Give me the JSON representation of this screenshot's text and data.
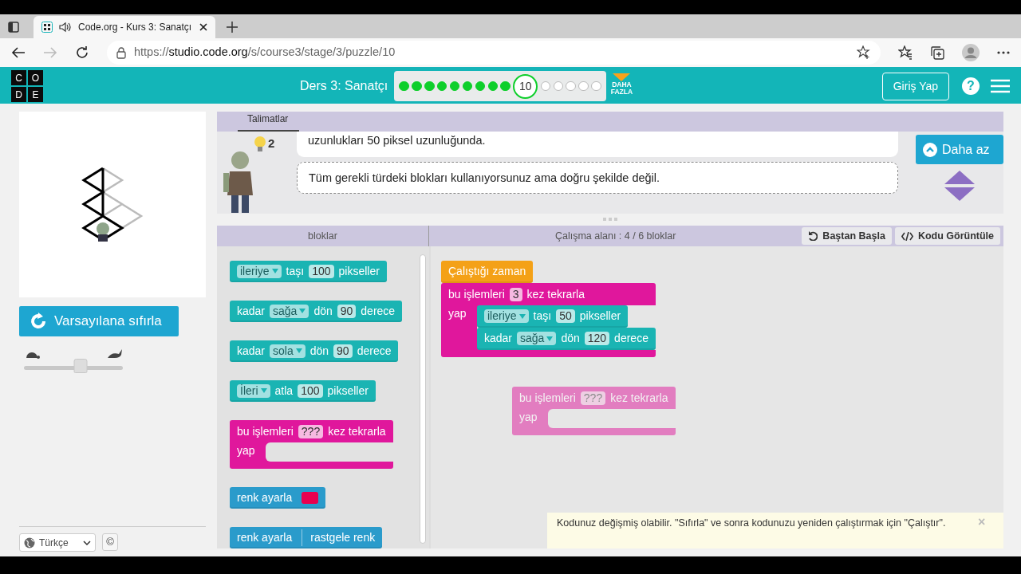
{
  "browser": {
    "tab_title": "Code.org - Kurs 3: Sanatçı",
    "url_scheme": "https://",
    "url_host": "studio.code.org",
    "url_path": "/s/course3/stage/3/puzzle/10"
  },
  "header": {
    "logo_letters": [
      "C",
      "O",
      "D",
      "E"
    ],
    "lesson": "Ders 3: Sanatçı",
    "more": [
      "DAHA",
      "FAZLA"
    ],
    "sign_in": "Giriş Yap",
    "help": "?",
    "progress": [
      {
        "completed": true,
        "selected": false
      },
      {
        "completed": true,
        "selected": false
      },
      {
        "completed": true,
        "selected": false
      },
      {
        "completed": true,
        "selected": false
      },
      {
        "completed": true,
        "selected": false
      },
      {
        "completed": true,
        "selected": false
      },
      {
        "completed": true,
        "selected": false
      },
      {
        "completed": true,
        "selected": false
      },
      {
        "completed": true,
        "selected": false
      },
      {
        "label": "10",
        "completed": false,
        "selected": true
      },
      {
        "completed": false,
        "selected": false
      },
      {
        "completed": false,
        "selected": false
      },
      {
        "completed": false,
        "selected": false
      },
      {
        "completed": false,
        "selected": false
      },
      {
        "completed": false,
        "selected": false
      }
    ]
  },
  "left": {
    "reset_button": "Varsayılana sıfırla",
    "speed": {
      "level": 0.57
    },
    "language": "Türkçe",
    "copyright": "©"
  },
  "instructions": {
    "tab": "Talimatlar",
    "hint_count": "2",
    "toggle_button": "Daha az",
    "messages": [
      {
        "kind": "instruction",
        "text": "uzunlukları 50 piksel uzunluğunda."
      },
      {
        "kind": "feedback",
        "text": "Tüm gerekli türdeki blokları kullanıyorsunuz ama doğru şekilde değil."
      }
    ]
  },
  "workspace_header": {
    "toolbox_title": "bloklar",
    "workspace_title": "Çalışma alanı : 4 / 6 bloklar",
    "buttons": [
      {
        "kind": "restart",
        "label": "Baştan Başla"
      },
      {
        "kind": "code",
        "label": "Kodu Görüntüle"
      }
    ]
  },
  "toolbox": [
    {
      "kind": "action",
      "parts": [
        {
          "kind": "dropdown",
          "text": "ileriye"
        },
        {
          "kind": "text",
          "text": "taşı"
        },
        {
          "kind": "number",
          "text": "100"
        },
        {
          "kind": "text",
          "text": "pikseller"
        }
      ]
    },
    {
      "kind": "action",
      "parts": [
        {
          "kind": "text",
          "text": "kadar"
        },
        {
          "kind": "dropdown",
          "text": "sağa"
        },
        {
          "kind": "text",
          "text": "dön"
        },
        {
          "kind": "number",
          "text": "90"
        },
        {
          "kind": "text",
          "text": "derece"
        }
      ]
    },
    {
      "kind": "action",
      "parts": [
        {
          "kind": "text",
          "text": "kadar"
        },
        {
          "kind": "dropdown",
          "text": "sola"
        },
        {
          "kind": "text",
          "text": "dön"
        },
        {
          "kind": "number",
          "text": "90"
        },
        {
          "kind": "text",
          "text": "derece"
        }
      ]
    },
    {
      "kind": "action",
      "parts": [
        {
          "kind": "dropdown",
          "text": "İleri"
        },
        {
          "kind": "text",
          "text": "atla"
        },
        {
          "kind": "number",
          "text": "100"
        },
        {
          "kind": "text",
          "text": "pikseller"
        }
      ]
    },
    {
      "kind": "repeat",
      "parts": [
        {
          "kind": "text",
          "text": "bu işlemleri"
        },
        {
          "kind": "number",
          "text": "???"
        },
        {
          "kind": "text",
          "text": "kez tekrarla"
        }
      ],
      "body_label": "yap"
    },
    {
      "kind": "pen",
      "parts": [
        {
          "kind": "text",
          "text": "renk ayarla"
        },
        {
          "kind": "swatch",
          "color": "#e8004f"
        }
      ]
    },
    {
      "kind": "pen",
      "parts": [
        {
          "kind": "text",
          "text": "renk ayarla"
        },
        {
          "kind": "value",
          "text": "rastgele renk"
        }
      ]
    }
  ],
  "workspace": [
    {
      "kind": "event",
      "disabled": false,
      "parts": [
        {
          "kind": "text",
          "text": "Çalıştığı zaman"
        }
      ],
      "next": [
        {
          "kind": "repeat",
          "parts": [
            {
              "kind": "text",
              "text": "bu işlemleri"
            },
            {
              "kind": "number",
              "text": "3"
            },
            {
              "kind": "text",
              "text": "kez tekrarla"
            }
          ],
          "body_label": "yap",
          "children": [
            {
              "kind": "action",
              "parts": [
                {
                  "kind": "dropdown",
                  "text": "ileriye"
                },
                {
                  "kind": "text",
                  "text": "taşı"
                },
                {
                  "kind": "number",
                  "text": "50"
                },
                {
                  "kind": "text",
                  "text": "pikseller"
                }
              ]
            },
            {
              "kind": "action",
              "parts": [
                {
                  "kind": "text",
                  "text": "kadar"
                },
                {
                  "kind": "dropdown",
                  "text": "sağa"
                },
                {
                  "kind": "text",
                  "text": "dön"
                },
                {
                  "kind": "number",
                  "text": "120"
                },
                {
                  "kind": "text",
                  "text": "derece"
                }
              ]
            }
          ]
        }
      ]
    },
    {
      "kind": "repeat",
      "disabled": true,
      "parts": [
        {
          "kind": "text",
          "text": "bu işlemleri"
        },
        {
          "kind": "number",
          "text": "???"
        },
        {
          "kind": "text",
          "text": "kez tekrarla"
        }
      ],
      "body_label": "yap"
    }
  ],
  "notice": {
    "text": "Kodunuz değişmiş olabilir. \"Sıfırla\" ve sonra kodunuzu yeniden çalıştırmak için \"Çalıştır\".",
    "close": "×"
  }
}
